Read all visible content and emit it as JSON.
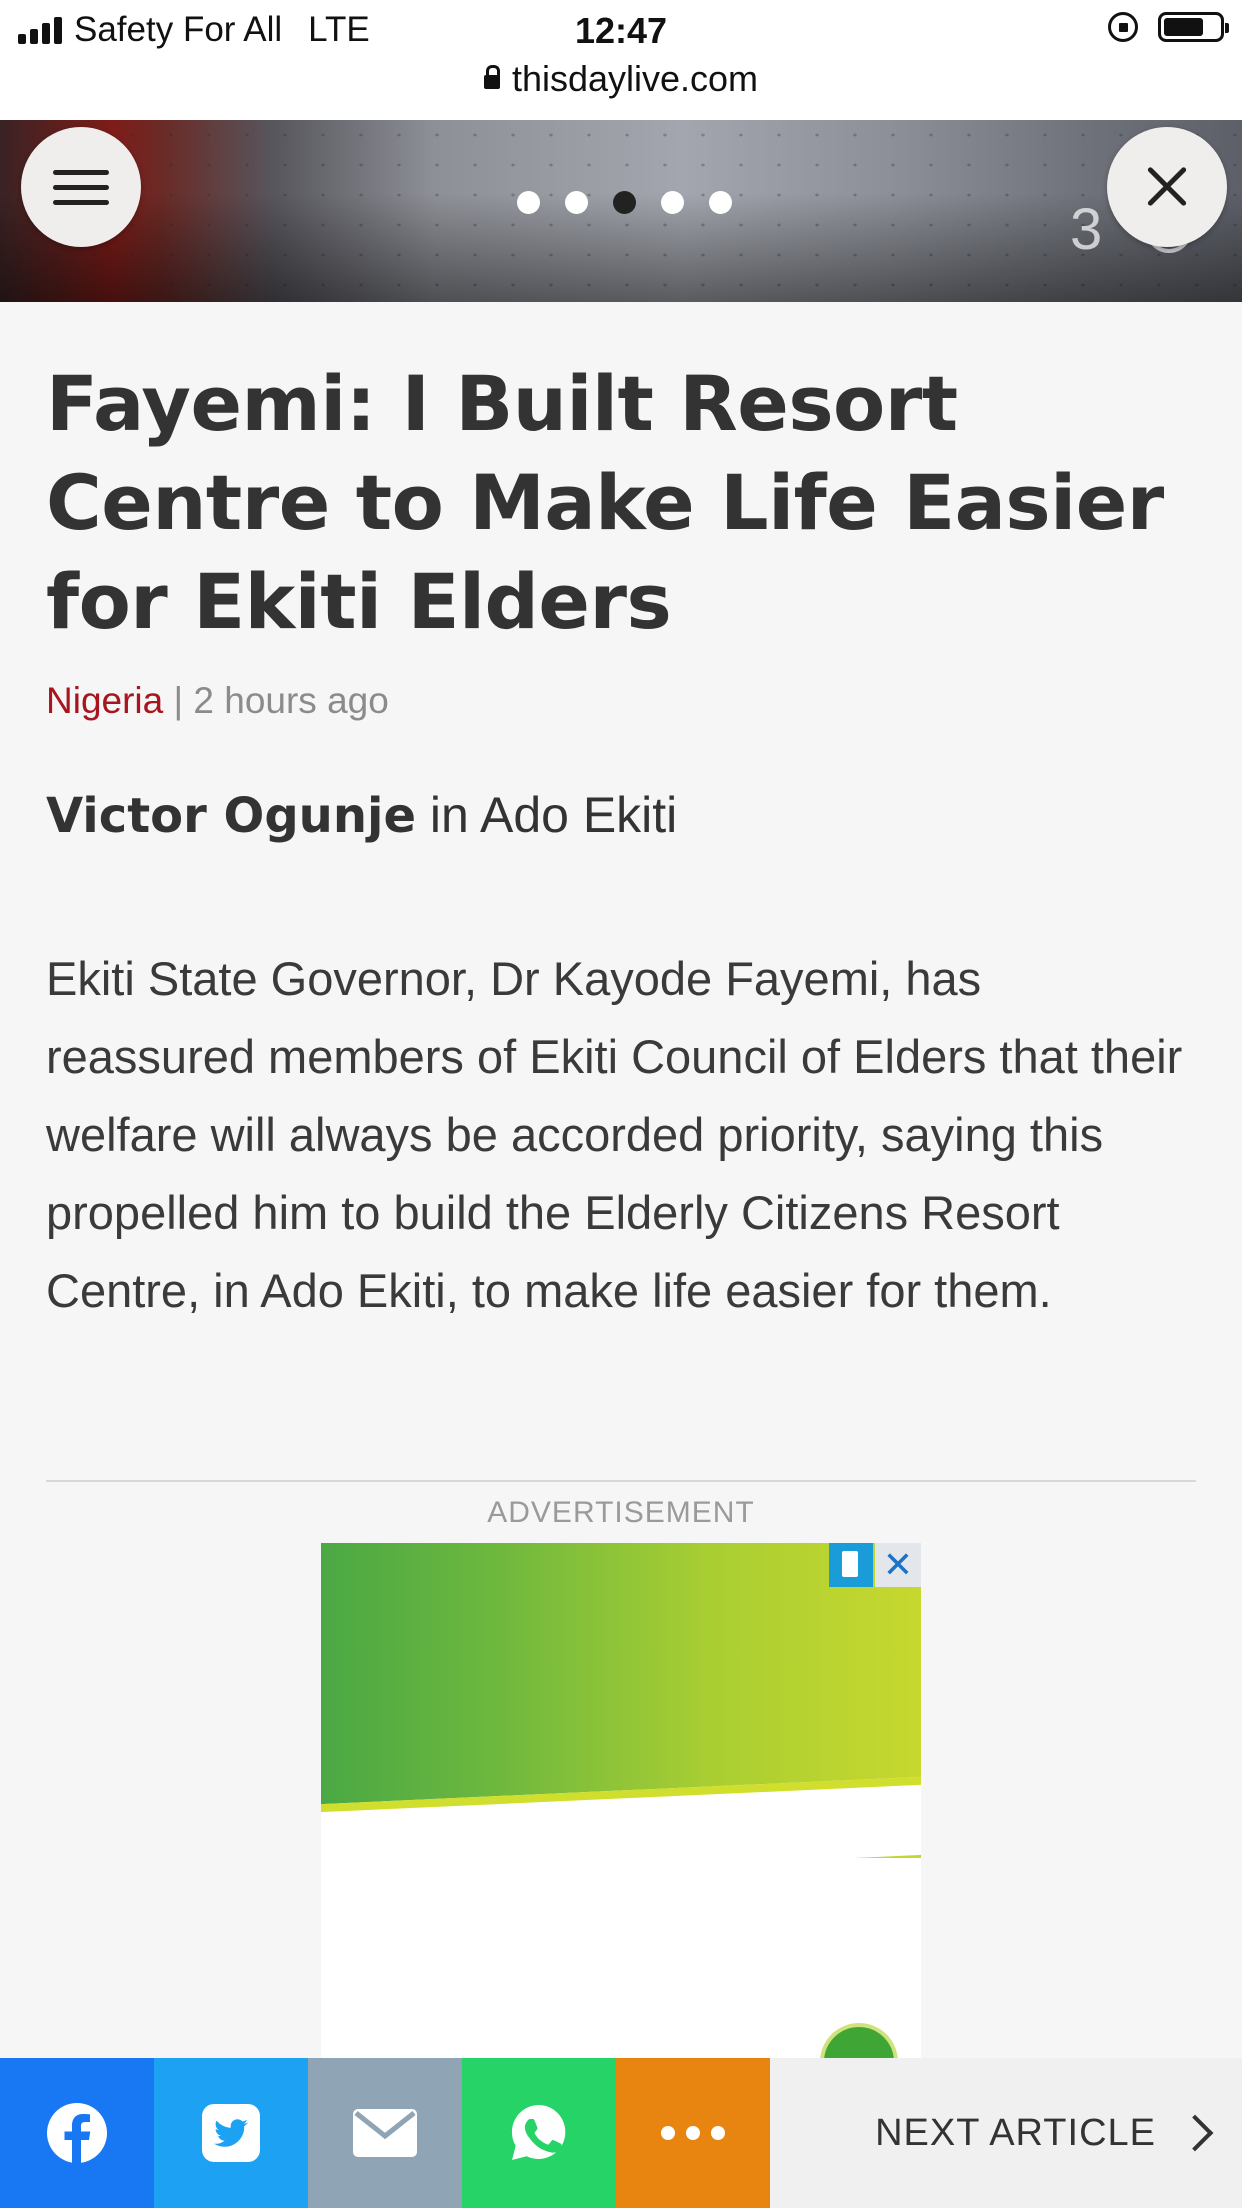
{
  "status_bar": {
    "carrier": "Safety For All",
    "network": "LTE",
    "time": "12:47",
    "battery_level": 0.72
  },
  "browser": {
    "url": "thisdaylive.com"
  },
  "hero": {
    "carousel_total": 5,
    "carousel_active_index": 2,
    "weather_text": "3"
  },
  "article": {
    "headline": "Fayemi: I Built Resort Centre to Make Life Easier for  Ekiti Elders",
    "category": "Nigeria",
    "separator": " | ",
    "time_ago": "2 hours ago",
    "author": "Victor Ogunje",
    "location": " in Ado Ekiti",
    "body": "Ekiti State Governor, Dr Kayode Fayemi, has reassured members of Ekiti Council of Elders that their welfare will always be accorded  priority, saying this propelled him  to build the  Elderly Citizens Resort Centre, in Ado Ekiti, to make life easier for them."
  },
  "ad": {
    "label": "ADVERTISEMENT",
    "close_glyph": "✕"
  },
  "share_bar": {
    "buttons": [
      "facebook",
      "twitter",
      "email",
      "whatsapp",
      "more"
    ],
    "next_label": "NEXT ARTICLE"
  },
  "colors": {
    "category_red": "#a8151e",
    "facebook": "#1877f2",
    "twitter": "#1da1f2",
    "email": "#8fa4b5",
    "whatsapp": "#25d366",
    "more": "#e88410"
  }
}
